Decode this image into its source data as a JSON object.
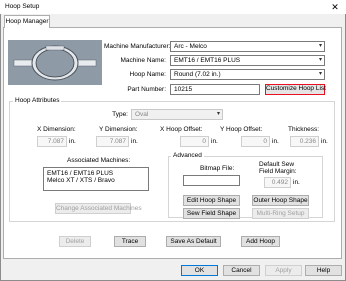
{
  "window": {
    "title": "Hoop Setup",
    "close_glyph": "✕"
  },
  "tabs": [
    {
      "label": "Hoop Manager"
    }
  ],
  "machine": {
    "manufacturer_label": "Machine Manufacturer:",
    "manufacturer_value": "Arc - Melco",
    "name_label": "Machine Name:",
    "name_value": "EMT16 / EMT16 PLUS",
    "hoop_name_label": "Hoop Name:",
    "hoop_name_value": "Round (7.02 in.)",
    "part_number_label": "Part Number:",
    "part_number_value": "10215",
    "customize_hoop_list_label": "Customize Hoop List"
  },
  "hoop_attributes": {
    "group_title": "Hoop Attributes",
    "type_label": "Type:",
    "type_value": "Oval",
    "x_dimension_label": "X Dimension:",
    "x_dimension_value": "7.087",
    "y_dimension_label": "Y Dimension:",
    "y_dimension_value": "7.087",
    "x_hoop_offset_label": "X Hoop Offset:",
    "x_hoop_offset_value": "0",
    "y_hoop_offset_label": "Y Hoop Offset:",
    "y_hoop_offset_value": "0",
    "thickness_label": "Thickness:",
    "thickness_value": "0.236",
    "unit": "in."
  },
  "associated_machines": {
    "label": "Associated Machines:",
    "items": [
      "EMT16 / EMT16 PLUS",
      "Melco XT / XTS / Bravo"
    ],
    "change_button_label": "Change Associated Machines"
  },
  "advanced": {
    "group_title": "Advanced",
    "bitmap_file_label": "Bitmap File:",
    "bitmap_file_value": "",
    "default_sew_field_margin_label_1": "Default Sew",
    "default_sew_field_margin_label_2": "Field Margin:",
    "default_sew_field_margin_value": "0.492",
    "unit": "in.",
    "edit_hoop_shape_label": "Edit Hoop Shape",
    "outer_hoop_shape_label": "Outer Hoop Shape",
    "sew_field_shape_label": "Sew Field Shape",
    "multi_ring_setup_label": "Multi-Ring Setup"
  },
  "actions": {
    "delete_label": "Delete",
    "trace_label": "Trace",
    "save_as_default_label": "Save As Default",
    "add_hoop_label": "Add Hoop"
  },
  "dialog_buttons": {
    "ok_label": "OK",
    "cancel_label": "Cancel",
    "apply_label": "Apply",
    "help_label": "Help"
  },
  "colors": {
    "highlight_border": "#e81123",
    "hoop_preview_bg": "#8e9aa5"
  },
  "icons": {
    "dropdown": "chevron-down-icon",
    "close": "close-icon"
  }
}
